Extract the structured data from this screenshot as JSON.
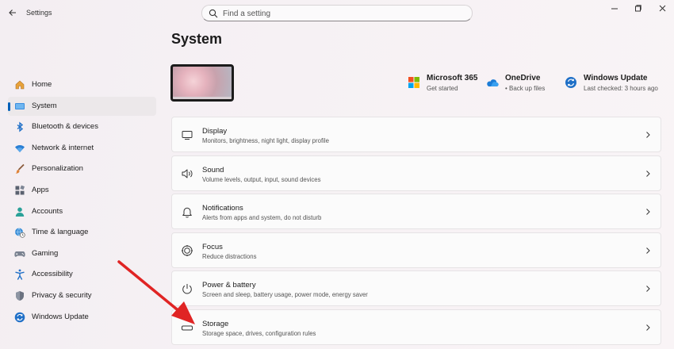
{
  "window": {
    "app_title": "Settings"
  },
  "search": {
    "placeholder": "Find a setting"
  },
  "sidebar": {
    "items": [
      {
        "label": "Home",
        "icon": "home-icon"
      },
      {
        "label": "System",
        "icon": "system-icon",
        "active": true
      },
      {
        "label": "Bluetooth & devices",
        "icon": "bluetooth-icon"
      },
      {
        "label": "Network & internet",
        "icon": "wifi-icon"
      },
      {
        "label": "Personalization",
        "icon": "brush-icon"
      },
      {
        "label": "Apps",
        "icon": "apps-icon"
      },
      {
        "label": "Accounts",
        "icon": "accounts-icon"
      },
      {
        "label": "Time & language",
        "icon": "globe-clock-icon"
      },
      {
        "label": "Gaming",
        "icon": "gamepad-icon"
      },
      {
        "label": "Accessibility",
        "icon": "accessibility-icon"
      },
      {
        "label": "Privacy & security",
        "icon": "shield-icon"
      },
      {
        "label": "Windows Update",
        "icon": "update-icon"
      }
    ]
  },
  "main": {
    "title": "System",
    "quick_cards": [
      {
        "title": "Microsoft 365",
        "sub": "Get started",
        "icon": "microsoft365-icon"
      },
      {
        "title": "OneDrive",
        "sub": "• Back up files",
        "icon": "onedrive-icon"
      },
      {
        "title": "Windows Update",
        "sub": "Last checked: 3 hours ago",
        "icon": "windows-update-icon"
      }
    ],
    "rows": [
      {
        "title": "Display",
        "sub": "Monitors, brightness, night light, display profile",
        "icon": "display-icon"
      },
      {
        "title": "Sound",
        "sub": "Volume levels, output, input, sound devices",
        "icon": "sound-icon"
      },
      {
        "title": "Notifications",
        "sub": "Alerts from apps and system, do not disturb",
        "icon": "bell-icon"
      },
      {
        "title": "Focus",
        "sub": "Reduce distractions",
        "icon": "focus-icon"
      },
      {
        "title": "Power & battery",
        "sub": "Screen and sleep, battery usage, power mode, energy saver",
        "icon": "power-icon"
      },
      {
        "title": "Storage",
        "sub": "Storage space, drives, configuration rules",
        "icon": "storage-icon"
      }
    ]
  },
  "colors": {
    "accent": "#0060b8",
    "annotation_arrow": "#e02424"
  }
}
